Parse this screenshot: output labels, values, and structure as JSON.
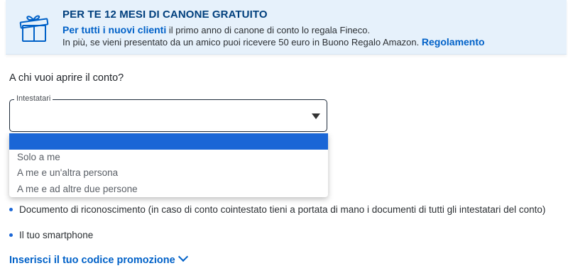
{
  "banner": {
    "icon": "gift-icon",
    "title": "PER TE 12 MESI DI CANONE GRATUITO",
    "line1_link": "Per tutti i nuovi clienti",
    "line1_rest": " il primo anno di canone di conto lo regala Fineco.",
    "line2_text": "In più, se vieni presentato da un amico puoi ricevere 50 euro in Buono Regalo Amazon.",
    "line2_link": "Regolamento"
  },
  "form": {
    "question": "A chi vuoi aprire il conto?",
    "select_label": "Intestatari",
    "options": [
      "",
      "Solo a me",
      "A me e un'altra persona",
      "A me e ad altre due persone"
    ]
  },
  "bullets": [
    "Documento di riconoscimento (in caso di conto cointestato tieni a portata di mano i documenti di tutti gli intestatari del conto)",
    "Il tuo smartphone"
  ],
  "promo_link": "Inserisci il tuo codice promozione",
  "colors": {
    "accent": "#0061c8",
    "banner_bg": "#e6f1fb",
    "selected_option": "#1a66d6"
  }
}
